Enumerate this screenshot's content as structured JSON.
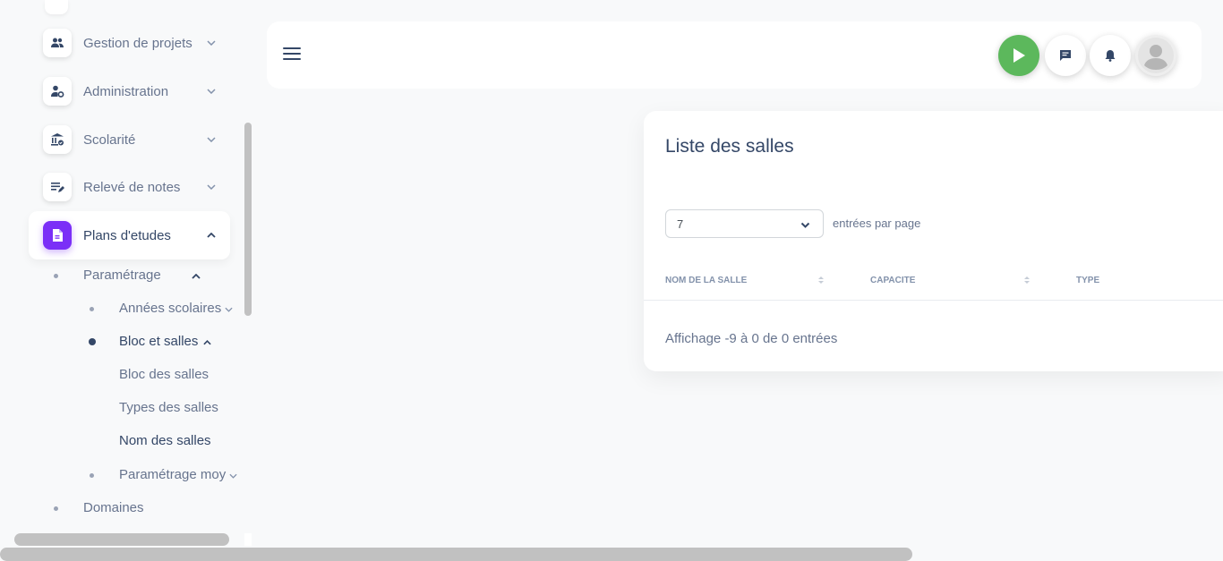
{
  "sidebar": {
    "items": [
      {
        "label": "Gestion de projets",
        "icon": "users-icon"
      },
      {
        "label": "Administration",
        "icon": "user-gear-icon"
      },
      {
        "label": "Scolarité",
        "icon": "bank-check-icon"
      },
      {
        "label": "Relevé de notes",
        "icon": "list-edit-icon"
      },
      {
        "label": "Plans d'etudes",
        "icon": "document-icon"
      }
    ],
    "sub": {
      "parametrage": "Paramétrage",
      "annees": "Années scolaires",
      "bloc_et_salles": "Bloc et salles",
      "bloc_des_salles": "Bloc des salles",
      "types_des_salles": "Types des salles",
      "nom_des_salles": "Nom des salles",
      "parametrage_moy": "Paramétrage moy",
      "domaines": "Domaines"
    }
  },
  "colors": {
    "accent": "#7b2ff7",
    "play": "#5cb85c",
    "text_dark": "#344767",
    "text_muted": "#67748e"
  },
  "card": {
    "title": "Liste des salles",
    "page_size": "7",
    "per_page_label": "entrées par page",
    "columns": [
      "NOM DE LA SALLE",
      "CAPACITE",
      "TYPE"
    ],
    "info": "Affichage -9 à 0 de 0 entrées"
  }
}
